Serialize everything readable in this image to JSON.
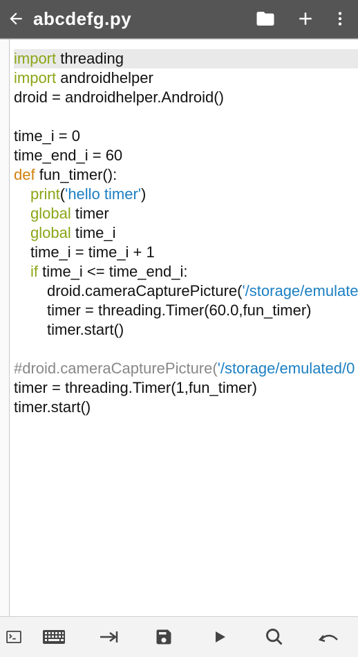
{
  "toolbar": {
    "title": "abcdefg.py"
  },
  "code": {
    "lines": [
      {
        "type": "hl",
        "segs": [
          {
            "c": "kw-olive",
            "t": "import"
          },
          {
            "c": "",
            "t": " threading"
          }
        ]
      },
      {
        "type": "",
        "segs": [
          {
            "c": "kw-olive",
            "t": "import"
          },
          {
            "c": "",
            "t": " androidhelper"
          }
        ]
      },
      {
        "type": "",
        "segs": [
          {
            "c": "",
            "t": "droid = androidhelper.Android()"
          }
        ]
      },
      {
        "type": "",
        "segs": [
          {
            "c": "",
            "t": ""
          }
        ]
      },
      {
        "type": "",
        "segs": [
          {
            "c": "",
            "t": "time_i = 0"
          }
        ]
      },
      {
        "type": "",
        "segs": [
          {
            "c": "",
            "t": "time_end_i = 60"
          }
        ]
      },
      {
        "type": "",
        "segs": [
          {
            "c": "kw-orange",
            "t": "def"
          },
          {
            "c": "",
            "t": " fun_timer():"
          }
        ]
      },
      {
        "type": "",
        "indent": "indent1",
        "segs": [
          {
            "c": "kw-olive",
            "t": "print"
          },
          {
            "c": "",
            "t": "("
          },
          {
            "c": "str-blue",
            "t": "'hello timer'"
          },
          {
            "c": "",
            "t": ")"
          }
        ]
      },
      {
        "type": "",
        "indent": "indent1",
        "segs": [
          {
            "c": "kw-olive",
            "t": "global"
          },
          {
            "c": "",
            "t": " timer"
          }
        ]
      },
      {
        "type": "",
        "indent": "indent1",
        "segs": [
          {
            "c": "kw-olive",
            "t": "global"
          },
          {
            "c": "",
            "t": " time_i"
          }
        ]
      },
      {
        "type": "",
        "indent": "indent1",
        "segs": [
          {
            "c": "",
            "t": "time_i = time_i + 1"
          }
        ]
      },
      {
        "type": "",
        "indent": "indent1",
        "segs": [
          {
            "c": "kw-olive",
            "t": "if"
          },
          {
            "c": "",
            "t": " time_i <= time_end_i:"
          }
        ]
      },
      {
        "type": "",
        "indent": "indent2",
        "segs": [
          {
            "c": "",
            "t": "droid.cameraCapturePicture("
          },
          {
            "c": "str-blue",
            "t": "'/storage/emulate"
          }
        ]
      },
      {
        "type": "",
        "indent": "indent2",
        "segs": [
          {
            "c": "",
            "t": "timer = threading.Timer(60.0,fun_timer)"
          }
        ]
      },
      {
        "type": "",
        "indent": "indent2",
        "segs": [
          {
            "c": "",
            "t": "timer.start()"
          }
        ]
      },
      {
        "type": "",
        "segs": [
          {
            "c": "",
            "t": ""
          }
        ]
      },
      {
        "type": "",
        "segs": [
          {
            "c": "comment-gray",
            "t": "#droid.cameraCapturePicture("
          },
          {
            "c": "str-blue",
            "t": "'/storage/emulated/0"
          }
        ]
      },
      {
        "type": "",
        "segs": [
          {
            "c": "",
            "t": "timer = threading.Timer(1,fun_timer)"
          }
        ]
      },
      {
        "type": "",
        "segs": [
          {
            "c": "",
            "t": "timer.start()"
          }
        ]
      }
    ]
  }
}
